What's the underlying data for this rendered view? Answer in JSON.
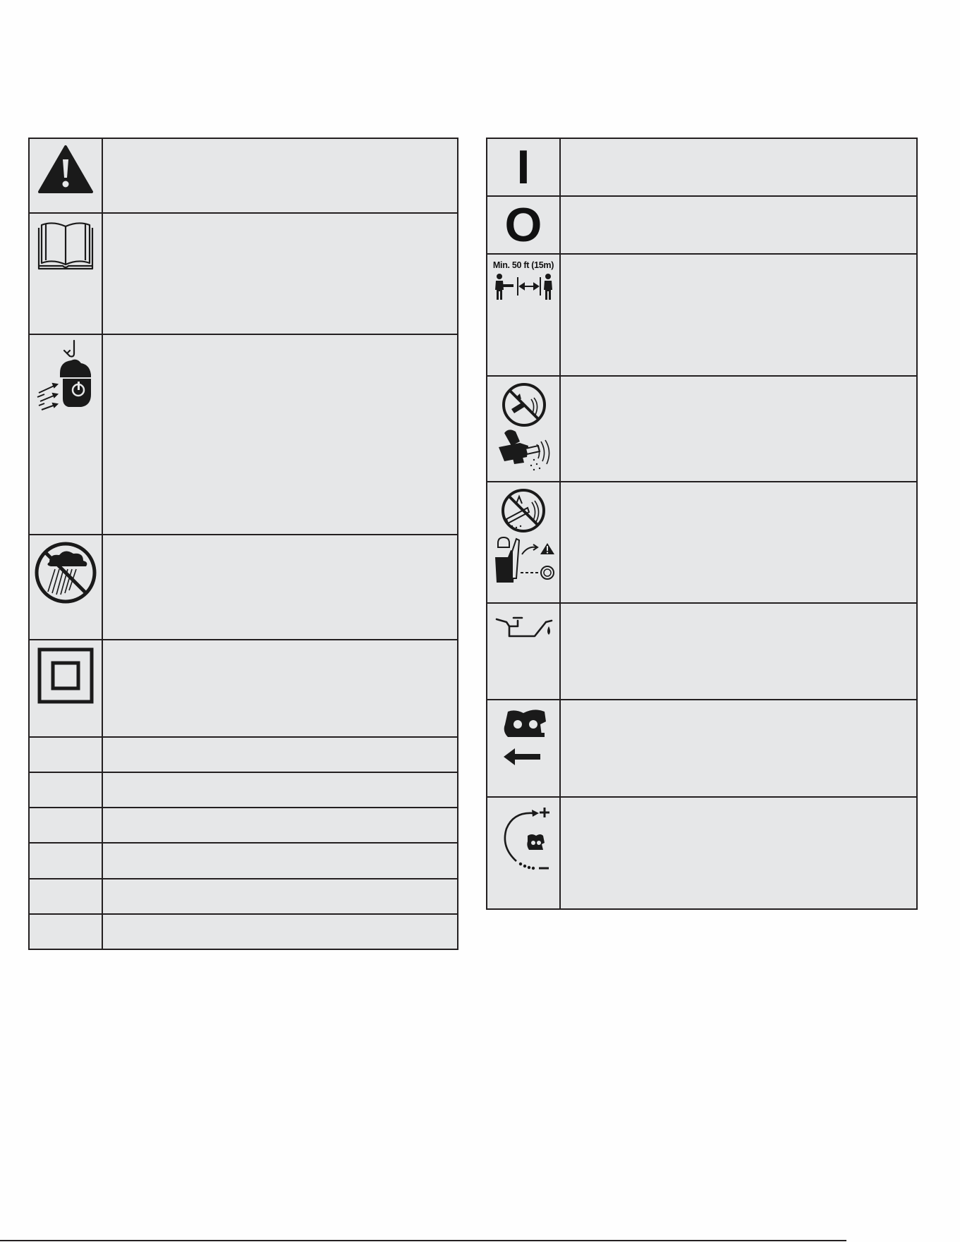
{
  "left_table": {
    "rows": [
      {
        "icon": "safety-alert-icon",
        "description": ""
      },
      {
        "icon": "read-manual-icon",
        "description": ""
      },
      {
        "icon": "eye-ear-head-protection-icon",
        "description": ""
      },
      {
        "icon": "no-rain-icon",
        "description": ""
      },
      {
        "icon": "double-insulation-icon",
        "description": ""
      },
      {
        "icon": "",
        "description": ""
      },
      {
        "icon": "",
        "description": ""
      },
      {
        "icon": "",
        "description": ""
      },
      {
        "icon": "",
        "description": ""
      },
      {
        "icon": "",
        "description": ""
      },
      {
        "icon": "",
        "description": ""
      }
    ]
  },
  "right_table": {
    "rows": [
      {
        "icon": "on-symbol-icon",
        "symbol": "I",
        "description": ""
      },
      {
        "icon": "off-symbol-icon",
        "symbol": "O",
        "description": ""
      },
      {
        "icon": "bystander-distance-icon",
        "label": "Min. 50 ft (15m)",
        "description": ""
      },
      {
        "icon": "kickback-tip-contact-icon",
        "description": ""
      },
      {
        "icon": "kickback-pinch-icon",
        "description": ""
      },
      {
        "icon": "oil-can-icon",
        "description": ""
      },
      {
        "icon": "chain-direction-icon",
        "description": ""
      },
      {
        "icon": "chain-tension-icon",
        "description": ""
      }
    ]
  },
  "colors": {
    "cell_fill": "#e6e7e8",
    "border": "#231f20",
    "icon": "#1a1a1a"
  }
}
